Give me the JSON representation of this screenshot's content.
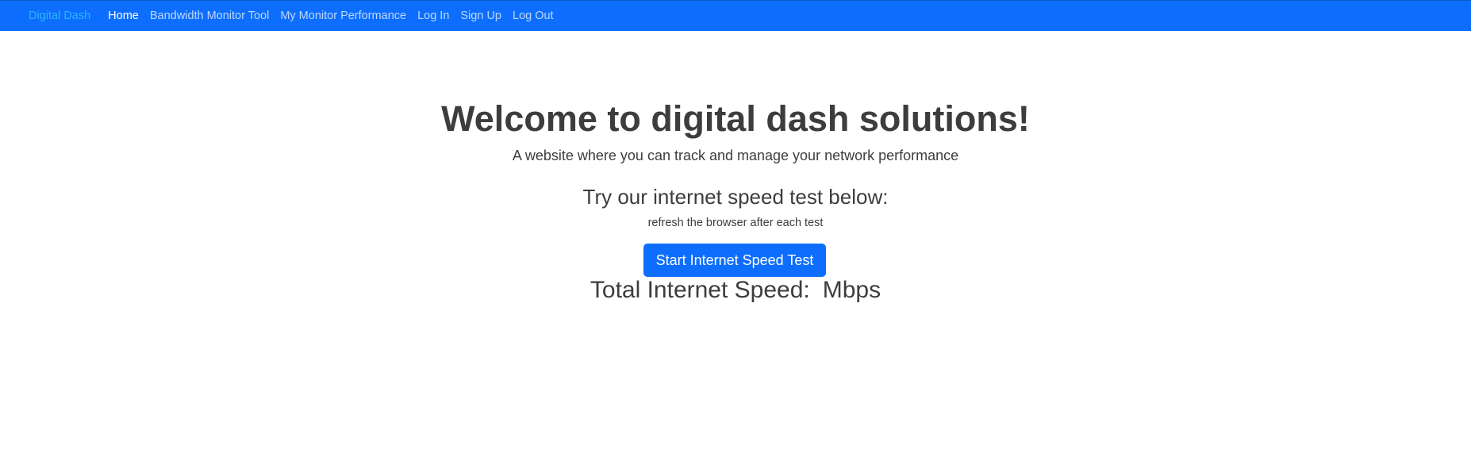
{
  "navbar": {
    "brand": "Digital Dash",
    "links": [
      {
        "label": "Home",
        "active": true
      },
      {
        "label": "Bandwidth Monitor Tool",
        "active": false
      },
      {
        "label": "My Monitor Performance",
        "active": false
      },
      {
        "label": "Log In",
        "active": false
      },
      {
        "label": "Sign Up",
        "active": false
      },
      {
        "label": "Log Out",
        "active": false
      }
    ]
  },
  "hero": {
    "title": "Welcome to digital dash solutions!",
    "subtitle": "A website where you can track and manage your network performance"
  },
  "speed_test": {
    "heading": "Try our internet speed test below:",
    "note": "refresh the browser after each test",
    "button_label": "Start Internet Speed Test",
    "result_label": "Total Internet Speed:",
    "result_value": "",
    "result_unit": "Mbps"
  },
  "colors": {
    "navbar_background": "#0d6efd",
    "brand_text": "#2bb5ff",
    "button_background": "#0d6efd",
    "body_text": "#3d3d3d"
  }
}
